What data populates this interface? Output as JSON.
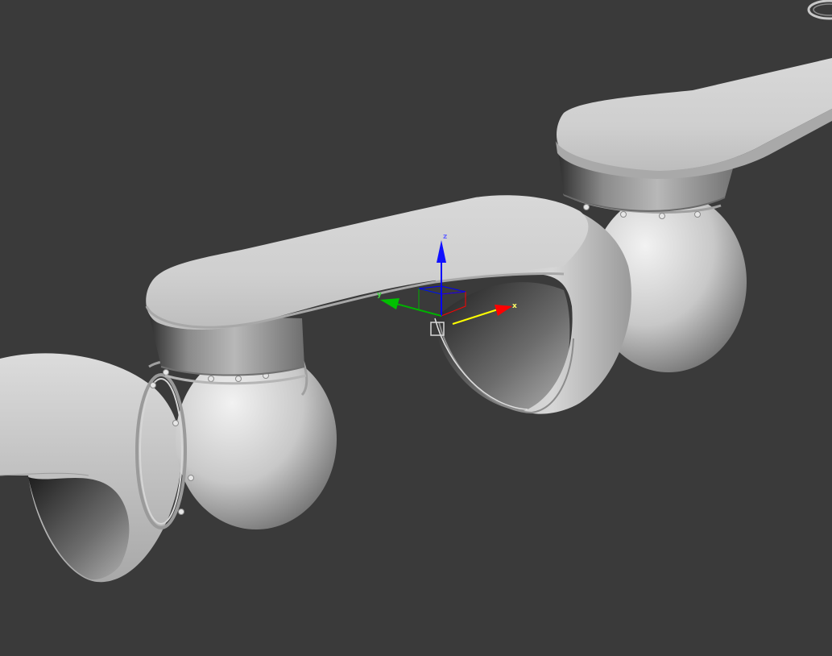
{
  "viewport": {
    "background": "#3a3a3a",
    "content": "robot-arm-3d-model"
  },
  "gizmo": {
    "axis_x_label": "x",
    "axis_y_label": "y",
    "axis_z_label": "z",
    "axis_x_color": "#ff0000",
    "axis_y_color": "#00b000",
    "axis_z_color": "#0000ff",
    "active_axis_color": "#ffff00"
  },
  "viewcube": {
    "icon": "viewcube-ring-icon"
  }
}
